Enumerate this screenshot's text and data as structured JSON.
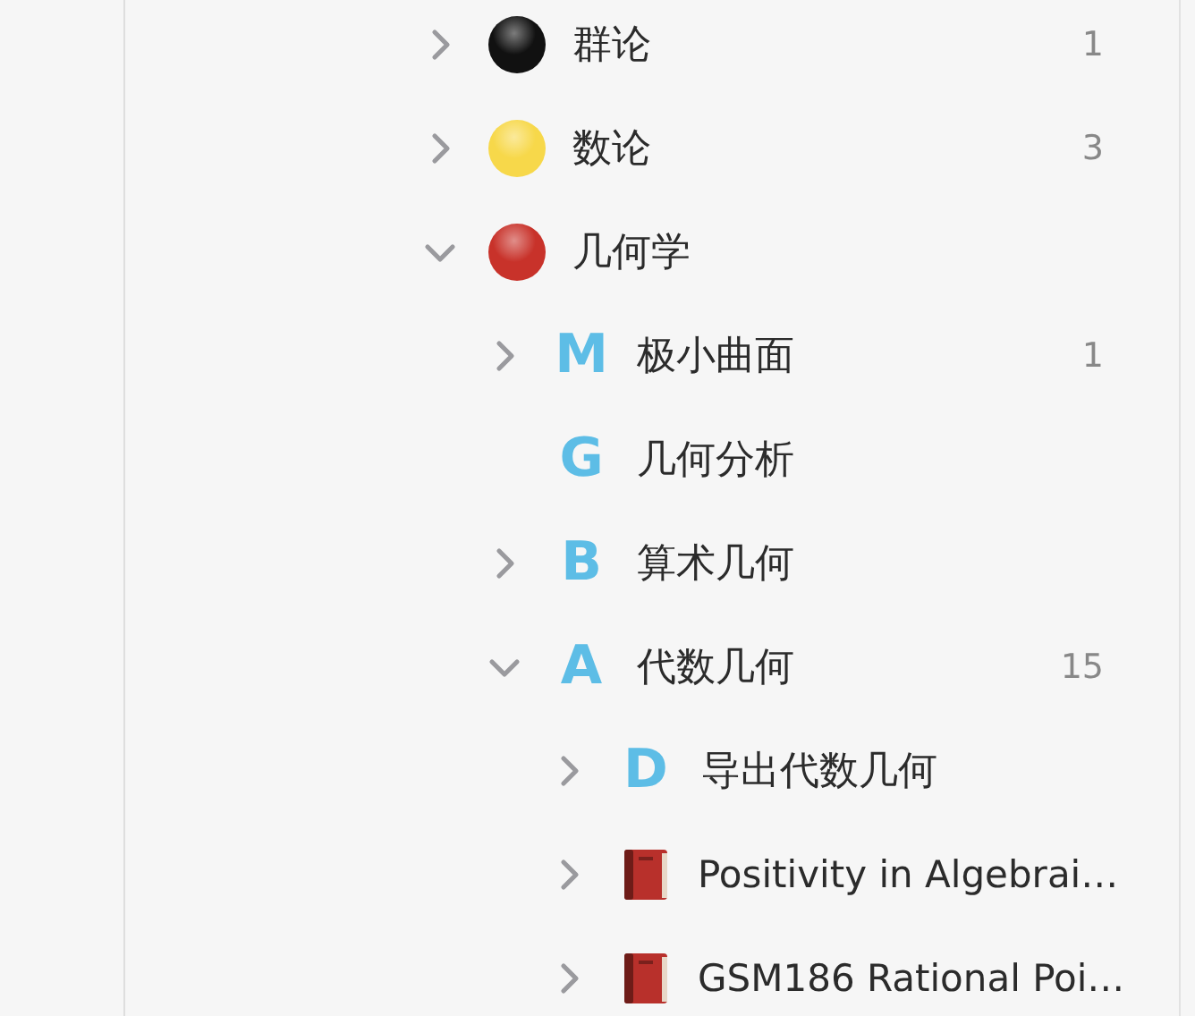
{
  "tree": [
    {
      "icon": {
        "kind": "dot",
        "color": "#111111"
      },
      "label": "群论",
      "count": "1",
      "expanded": false
    },
    {
      "icon": {
        "kind": "dot",
        "color": "#f7d84a"
      },
      "label": "数论",
      "count": "3",
      "expanded": false
    },
    {
      "icon": {
        "kind": "dot",
        "color": "#c8322a"
      },
      "label": "几何学",
      "expanded": true,
      "children": [
        {
          "icon": {
            "kind": "letter",
            "letter": "M"
          },
          "label": "极小曲面",
          "count": "1",
          "expanded": false
        },
        {
          "icon": {
            "kind": "letter",
            "letter": "G"
          },
          "label": "几何分析"
        },
        {
          "icon": {
            "kind": "letter",
            "letter": "B"
          },
          "label": "算术几何",
          "expanded": false
        },
        {
          "icon": {
            "kind": "letter",
            "letter": "A"
          },
          "label": "代数几何",
          "count": "15",
          "expanded": true,
          "children": [
            {
              "icon": {
                "kind": "letter",
                "letter": "D"
              },
              "label": "导出代数几何",
              "expanded": false
            },
            {
              "icon": {
                "kind": "book"
              },
              "label": "Positivity in Algebrai…",
              "expanded": false
            },
            {
              "icon": {
                "kind": "book"
              },
              "label": "GSM186 Rational Poi…",
              "expanded": false
            }
          ]
        }
      ]
    }
  ]
}
